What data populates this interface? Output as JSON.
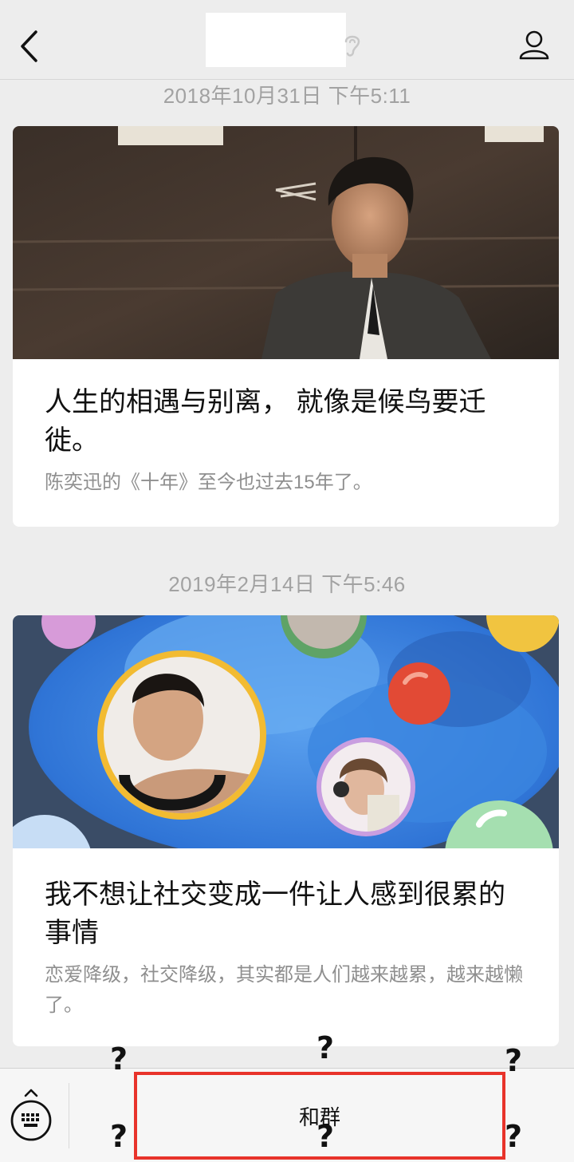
{
  "nav": {
    "back_icon": "chevron-left-icon",
    "listen_icon": "ear-icon",
    "profile_icon": "person-icon"
  },
  "messages": [
    {
      "timestamp": "2018年10月31日 下午5:11",
      "title": "人生的相遇与别离， 就像是候鸟要迁徙。",
      "desc": "陈奕迅的《十年》至今也过去15年了。"
    },
    {
      "timestamp": "2019年2月14日 下午5:46",
      "title": "我不想让社交变成一件让人感到很累的事情",
      "desc": "恋爱降级，社交降级，其实都是人们越来越累，越来越懒了。"
    }
  ],
  "bottom_bar": {
    "keyboard_icon": "keyboard-icon",
    "menu_label": "和群",
    "question_mark": "?"
  },
  "colors": {
    "highlight": "#e8332b",
    "background": "#ededed"
  }
}
